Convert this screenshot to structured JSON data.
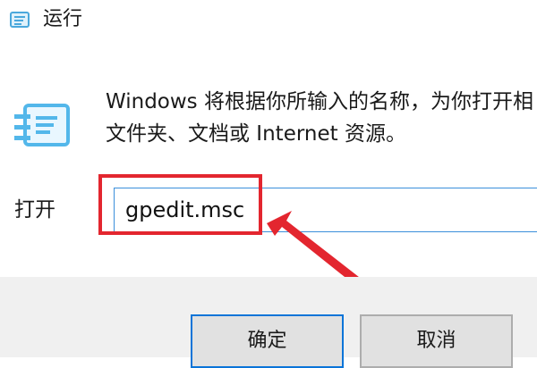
{
  "window": {
    "title": "运行",
    "icon": "run-dialog-icon"
  },
  "dialog": {
    "icon": "run-program-icon",
    "message_line1": "Windows 将根据你所输入的名称，为你打开相",
    "message_line2": "文件夹、文档或 Internet 资源。",
    "open_label": "打开",
    "open_value": "gpedit.msc"
  },
  "buttons": {
    "ok": "确定",
    "cancel": "取消"
  },
  "annotation": {
    "highlight_color": "#e3262f",
    "arrow_color": "#e3262f"
  },
  "colors": {
    "input_border": "#3b8fdb",
    "focus_border": "#0a74d8",
    "footer_bg": "#f0f0f0"
  }
}
